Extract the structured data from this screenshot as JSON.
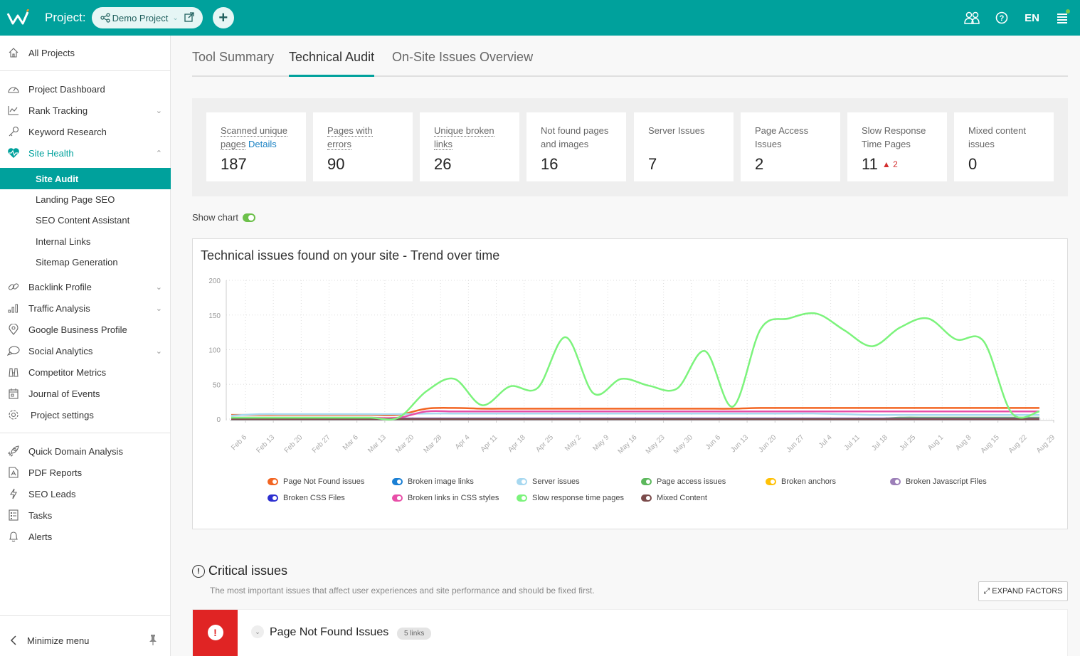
{
  "topbar": {
    "project_label": "Project:",
    "project_name": "Demo Project",
    "language": "EN",
    "icons": [
      "users-icon",
      "help-icon",
      "menu-icon"
    ]
  },
  "sidebar": {
    "all_projects": "All Projects",
    "items": [
      {
        "label": "Project Dashboard",
        "icon": "dashboard-icon"
      },
      {
        "label": "Rank Tracking",
        "icon": "chart-line-icon",
        "expandable": true
      },
      {
        "label": "Keyword Research",
        "icon": "key-icon"
      },
      {
        "label": "Site Health",
        "icon": "heart-pulse-icon",
        "expanded": true
      },
      {
        "label": "Backlink Profile",
        "icon": "link-icon",
        "expandable": true
      },
      {
        "label": "Traffic Analysis",
        "icon": "bar-chart-icon",
        "expandable": true
      },
      {
        "label": "Google Business Profile",
        "icon": "map-pin-icon"
      },
      {
        "label": "Social Analytics",
        "icon": "chat-bubble-icon",
        "expandable": true
      },
      {
        "label": "Competitor Metrics",
        "icon": "binoculars-icon"
      },
      {
        "label": "Journal of Events",
        "icon": "calendar-icon"
      },
      {
        "label": "Project settings",
        "icon": "gear-icon"
      }
    ],
    "site_health_sub": [
      "Site Audit",
      "Landing Page SEO",
      "SEO Content Assistant",
      "Internal Links",
      "Sitemap Generation"
    ],
    "active_sub": "Site Audit",
    "tools": [
      {
        "label": "Quick Domain Analysis",
        "icon": "rocket-icon"
      },
      {
        "label": "PDF Reports",
        "icon": "pdf-icon"
      },
      {
        "label": "SEO Leads",
        "icon": "lightning-icon"
      },
      {
        "label": "Tasks",
        "icon": "tasks-icon"
      },
      {
        "label": "Alerts",
        "icon": "bell-icon"
      }
    ],
    "minimize": "Minimize menu"
  },
  "tabs": [
    {
      "label": "Tool Summary",
      "active": false
    },
    {
      "label": "Technical Audit",
      "active": true
    },
    {
      "label": "On-Site Issues Overview",
      "active": false
    }
  ],
  "stats": [
    {
      "title_a": "Scanned unique",
      "title_b": "pages",
      "link": "Details",
      "value": "187",
      "underlined": true
    },
    {
      "title_a": "Pages with",
      "title_b": "errors",
      "value": "90",
      "underlined": true
    },
    {
      "title_a": "Unique broken",
      "title_b": "links",
      "value": "26",
      "underlined": true
    },
    {
      "title_a": "Not found pages",
      "title_b": "and images",
      "value": "16"
    },
    {
      "title_a": "Server Issues",
      "title_b": "",
      "value": "7"
    },
    {
      "title_a": "Page Access",
      "title_b": "Issues",
      "value": "2"
    },
    {
      "title_a": "Slow Response",
      "title_b": "Time Pages",
      "value": "11",
      "delta": "2"
    },
    {
      "title_a": "Mixed content",
      "title_b": "issues",
      "value": "0"
    }
  ],
  "show_chart": {
    "label": "Show chart",
    "on": true
  },
  "chart_data": {
    "type": "line",
    "title": "Technical issues found on your site - Trend over time",
    "xlabel": "",
    "ylabel": "",
    "ylim": [
      0,
      200
    ],
    "yticks": [
      0,
      50,
      100,
      150,
      200
    ],
    "grid": true,
    "legend_position": "bottom",
    "x": [
      "Feb 6",
      "Feb 13",
      "Feb 20",
      "Feb 27",
      "Mar 6",
      "Mar 13",
      "Mar 20",
      "Mar 28",
      "Apr 4",
      "Apr 11",
      "Apr 18",
      "Apr 25",
      "May 2",
      "May 9",
      "May 16",
      "May 23",
      "May 30",
      "Jun 6",
      "Jun 13",
      "Jun 20",
      "Jun 27",
      "Jul 4",
      "Jul 11",
      "Jul 18",
      "Jul 25",
      "Aug 1",
      "Aug 8",
      "Aug 15",
      "Aug 22",
      "Aug 29"
    ],
    "series": [
      {
        "name": "Page Not Found issues",
        "color": "#f26522",
        "values": [
          6,
          6,
          6,
          6,
          6,
          6,
          6,
          15,
          16,
          15,
          15,
          15,
          15,
          15,
          15,
          15,
          15,
          15,
          15,
          16,
          16,
          16,
          16,
          16,
          16,
          16,
          16,
          16,
          16,
          16
        ]
      },
      {
        "name": "Broken image links",
        "color": "#1a7fd4",
        "values": [
          0,
          0,
          0,
          0,
          0,
          0,
          0,
          0,
          0,
          0,
          0,
          0,
          0,
          0,
          0,
          0,
          0,
          0,
          0,
          0,
          0,
          0,
          0,
          0,
          0,
          0,
          0,
          0,
          0,
          0
        ]
      },
      {
        "name": "Server issues",
        "color": "#a7d8f0",
        "values": [
          5,
          7,
          7,
          7,
          7,
          7,
          7,
          8,
          8,
          8,
          8,
          8,
          8,
          8,
          8,
          8,
          8,
          8,
          8,
          8,
          8,
          8,
          7,
          6,
          6,
          6,
          6,
          6,
          6,
          6
        ]
      },
      {
        "name": "Page access issues",
        "color": "#5cb85c",
        "values": [
          0,
          0,
          0,
          0,
          0,
          0,
          0,
          0,
          0,
          0,
          0,
          0,
          0,
          0,
          0,
          0,
          0,
          0,
          0,
          0,
          0,
          0,
          0,
          0,
          2,
          2,
          2,
          2,
          2,
          2
        ]
      },
      {
        "name": "Broken anchors",
        "color": "#ffc107",
        "values": [
          0,
          0,
          0,
          0,
          0,
          0,
          0,
          0,
          0,
          0,
          0,
          0,
          0,
          0,
          0,
          0,
          0,
          0,
          0,
          0,
          0,
          0,
          0,
          0,
          0,
          0,
          0,
          0,
          0,
          0
        ]
      },
      {
        "name": "Broken Javascript Files",
        "color": "#9c7fb8",
        "values": [
          1,
          1,
          1,
          1,
          1,
          1,
          1,
          1,
          1,
          1,
          1,
          1,
          1,
          1,
          1,
          1,
          1,
          1,
          1,
          1,
          1,
          1,
          1,
          1,
          1,
          1,
          1,
          1,
          1,
          1
        ]
      },
      {
        "name": "Broken CSS Files",
        "color": "#2d2fd0",
        "values": [
          0,
          0,
          0,
          0,
          0,
          0,
          0,
          0,
          0,
          0,
          0,
          0,
          0,
          0,
          0,
          0,
          0,
          0,
          0,
          0,
          0,
          0,
          0,
          0,
          0,
          0,
          0,
          0,
          0,
          0
        ]
      },
      {
        "name": "Broken links in CSS styles",
        "color": "#e84fa8",
        "values": [
          2,
          2,
          2,
          2,
          2,
          2,
          2,
          11,
          11,
          11,
          11,
          11,
          11,
          11,
          11,
          11,
          11,
          11,
          11,
          11,
          11,
          11,
          11,
          11,
          11,
          11,
          11,
          11,
          11,
          11
        ]
      },
      {
        "name": "Slow response time pages",
        "color": "#7cf37c",
        "values": [
          2,
          2,
          2,
          2,
          2,
          2,
          2,
          40,
          58,
          20,
          47,
          45,
          118,
          37,
          58,
          48,
          44,
          98,
          18,
          130,
          145,
          152,
          128,
          105,
          132,
          145,
          115,
          112,
          9,
          11
        ]
      },
      {
        "name": "Mixed Content",
        "color": "#7b4b4b",
        "values": [
          0,
          0,
          0,
          0,
          0,
          0,
          0,
          0,
          0,
          0,
          0,
          0,
          0,
          0,
          0,
          0,
          0,
          0,
          0,
          0,
          0,
          0,
          0,
          0,
          0,
          0,
          0,
          0,
          0,
          0
        ]
      }
    ]
  },
  "critical": {
    "title": "Critical issues",
    "description": "The most important issues that affect user experiences and site performance and should be fixed first.",
    "expand_label": "EXPAND FACTORS",
    "issues": [
      {
        "title": "Page Not Found Issues",
        "badge": "5 links"
      }
    ]
  }
}
